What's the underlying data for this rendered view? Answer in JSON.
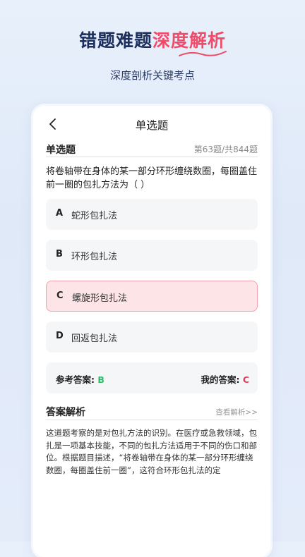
{
  "hero": {
    "title_part1": "错题难题",
    "title_part2": "深度解析",
    "subtitle": "深度剖析关键考点"
  },
  "nav": {
    "back_icon": "chevron-left-icon",
    "title": "单选题"
  },
  "question": {
    "type_label": "单选题",
    "progress": "第63题/共844题",
    "text": "将卷轴带在身体的某一部分环形缠绕数圈，每圈盖住前一圈的包扎方法为（ ）",
    "options": [
      {
        "letter": "A",
        "text": "蛇形包扎法",
        "state": "normal"
      },
      {
        "letter": "B",
        "text": "环形包扎法",
        "state": "normal"
      },
      {
        "letter": "C",
        "text": "螺旋形包扎法",
        "state": "wrong"
      },
      {
        "letter": "D",
        "text": "回返包扎法",
        "state": "normal"
      }
    ]
  },
  "answers": {
    "reference_label": "参考答案: ",
    "reference_value": "B",
    "mine_label": "我的答案: ",
    "mine_value": "C"
  },
  "explanation": {
    "title": "答案解析",
    "link": "查看解析>>",
    "text": "这道题考察的是对包扎方法的识别。在医疗或急救领域，包扎是一项基本技能，不同的包扎方法适用于不同的伤口和部位。根据题目描述，“将卷轴带在身体的某一部分环形缠绕数圈，每圈盖住前一圈”，这符合环形包扎法的定"
  },
  "colors": {
    "brand_dark": "#1c2f5e",
    "accent": "#f04b6a",
    "correct": "#2ebd6b",
    "wrong": "#e83b52"
  }
}
